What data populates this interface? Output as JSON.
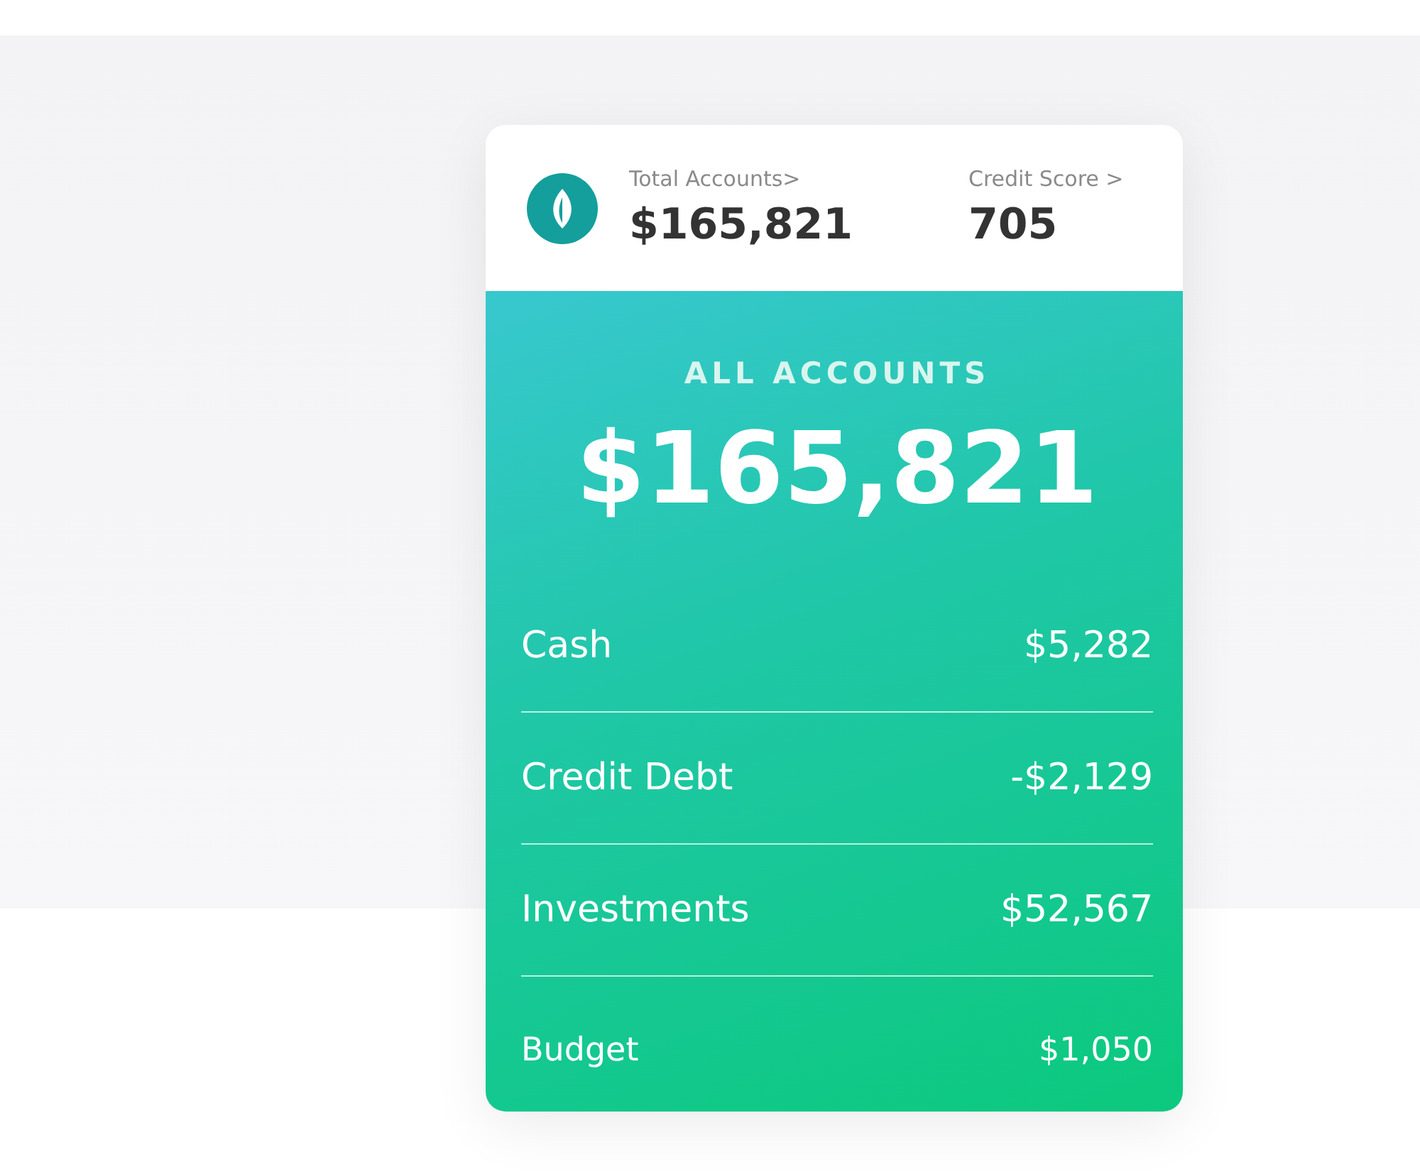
{
  "header": {
    "stats": [
      {
        "label": "Total Accounts>",
        "value": "$165,821"
      },
      {
        "label": "Credit Score >",
        "value": "705"
      }
    ]
  },
  "summary": {
    "title": "ALL ACCOUNTS",
    "total": "$165,821"
  },
  "rows": [
    {
      "label": "Cash",
      "amount": "$5,282"
    },
    {
      "label": "Credit Debt",
      "amount": "-$2,129"
    },
    {
      "label": "Investments",
      "amount": "$52,567"
    },
    {
      "label": "Budget",
      "amount": "$1,050"
    }
  ]
}
